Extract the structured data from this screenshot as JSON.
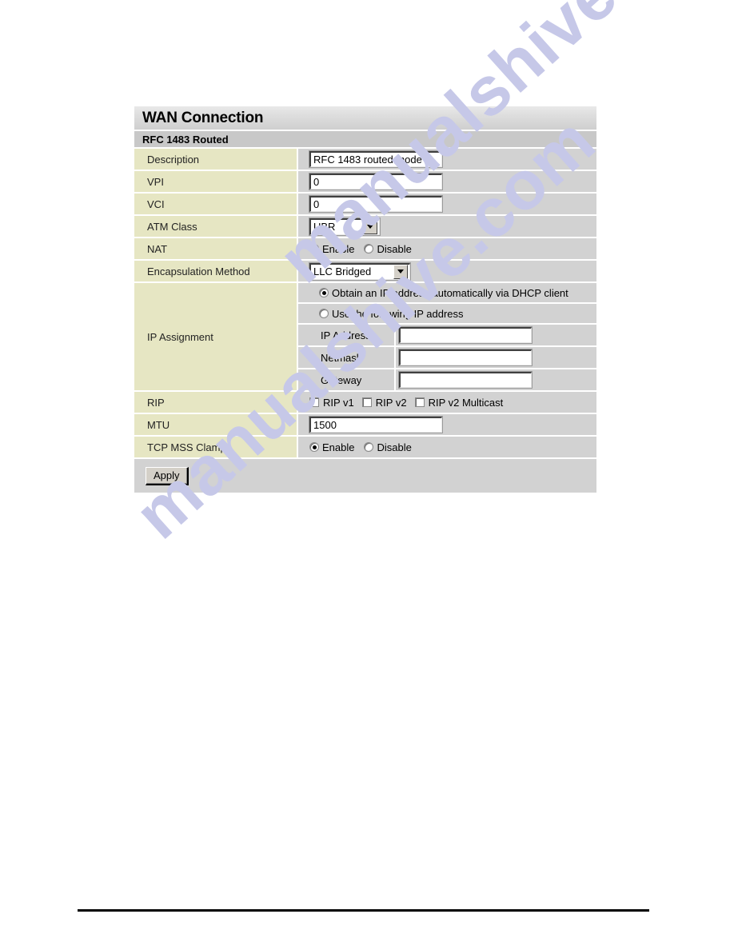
{
  "panel": {
    "title": "WAN Connection",
    "subtitle": "RFC 1483 Routed",
    "rows": {
      "description": {
        "label": "Description",
        "value": "RFC 1483 routed mode"
      },
      "vpi": {
        "label": "VPI",
        "value": "0"
      },
      "vci": {
        "label": "VCI",
        "value": "0"
      },
      "atm_class": {
        "label": "ATM Class",
        "value": "UBR"
      },
      "nat": {
        "label": "NAT",
        "options": [
          {
            "label": "Enable",
            "selected": true
          },
          {
            "label": "Disable",
            "selected": false
          }
        ]
      },
      "encapsulation": {
        "label": "Encapsulation Method",
        "value": "LLC Bridged"
      },
      "ip_assignment": {
        "label": "IP Assignment",
        "options": [
          {
            "label": "Obtain an IP address automatically via DHCP client",
            "selected": true
          },
          {
            "label": "Use the following IP address",
            "selected": false
          }
        ],
        "fields": [
          {
            "label": "IP Address",
            "value": ""
          },
          {
            "label": "Netmask",
            "value": ""
          },
          {
            "label": "Gateway",
            "value": ""
          }
        ]
      },
      "rip": {
        "label": "RIP",
        "options": [
          {
            "label": "RIP v1",
            "checked": false
          },
          {
            "label": "RIP v2",
            "checked": false
          },
          {
            "label": "RIP v2 Multicast",
            "checked": false
          }
        ]
      },
      "mtu": {
        "label": "MTU",
        "value": "1500"
      },
      "tcp_mss_clamp": {
        "label": "TCP MSS Clamp",
        "options": [
          {
            "label": "Enable",
            "selected": true
          },
          {
            "label": "Disable",
            "selected": false
          }
        ]
      }
    },
    "apply_label": "Apply"
  },
  "watermark": {
    "line1": "manualshive.com",
    "line2": "manualshive.com"
  },
  "colors": {
    "label_bg": "#e6e6c3",
    "field_bg": "#d2d2d2",
    "subtitle_bg": "#c8c8c8",
    "watermark": "#c6c8e8"
  }
}
